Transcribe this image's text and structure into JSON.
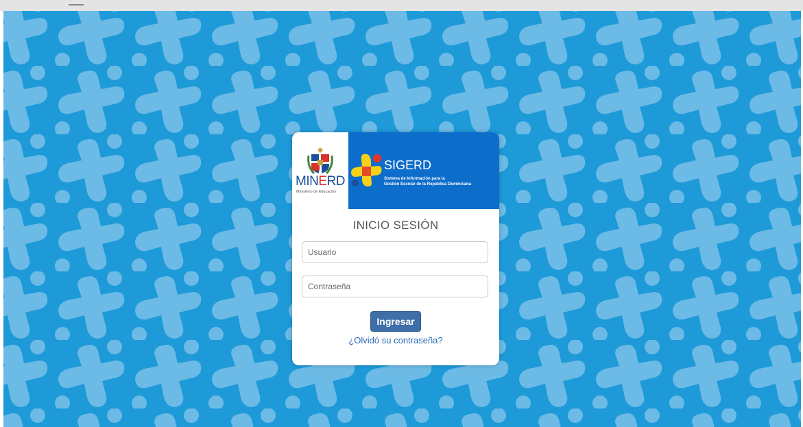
{
  "colors": {
    "background": "#1e9ad8",
    "pattern": "#6cbae6",
    "header_blue": "#0d6dcb",
    "button": "#3f6fa8",
    "link": "#2a6bb5"
  },
  "brand": {
    "minerd_part1": "MIN",
    "minerd_part2": "E",
    "minerd_part3": "RD",
    "minerd_subtitle": "Ministerio de Educación",
    "sigerd_title": "SIGERD",
    "sigerd_line1": "Sistema de Información para la",
    "sigerd_line2": "Gestión Escolar de la República Dominicana",
    "coat_of_arms_icon": "coat-of-arms-icon",
    "sigerd_logo_icon": "sigerd-cross-icon"
  },
  "login": {
    "title": "INICIO SESIÓN",
    "username_placeholder": "Usuario",
    "password_placeholder": "Contraseña",
    "submit_label": "Ingresar",
    "forgot_label": "¿Olvidó su contraseña?"
  }
}
